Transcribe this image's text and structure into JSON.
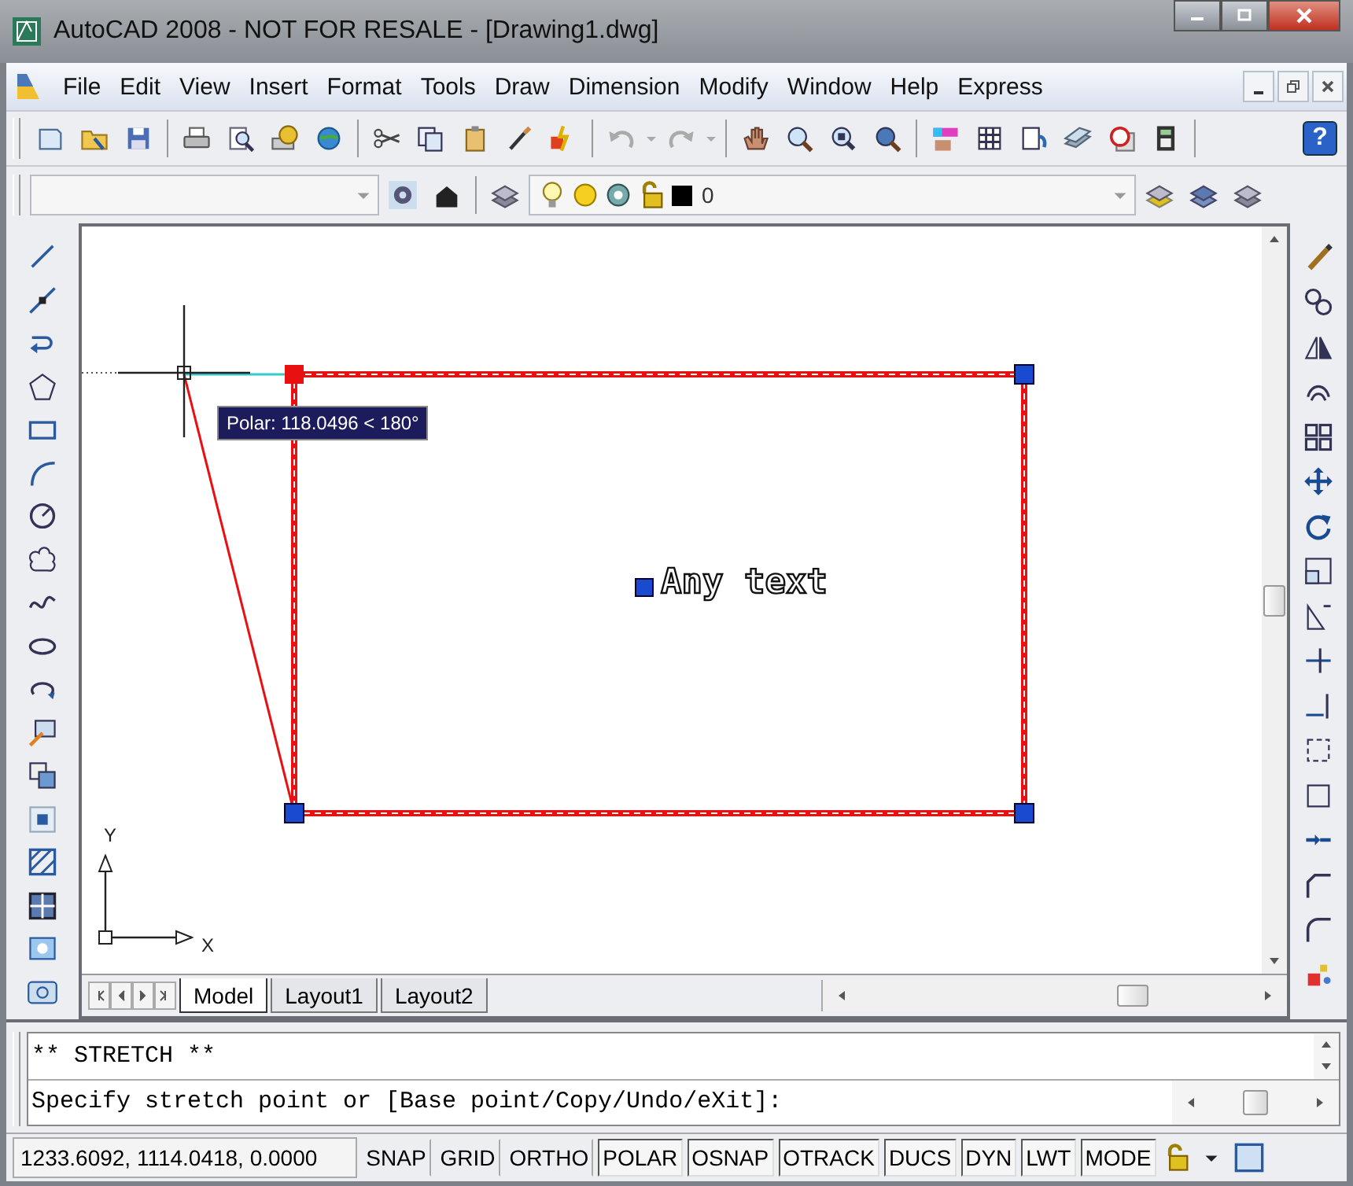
{
  "window": {
    "title": "AutoCAD 2008 - NOT FOR RESALE - [Drawing1.dwg]"
  },
  "menu": {
    "items": [
      "File",
      "Edit",
      "View",
      "Insert",
      "Format",
      "Tools",
      "Draw",
      "Dimension",
      "Modify",
      "Window",
      "Help",
      "Express"
    ]
  },
  "standard_toolbar": {
    "help_button": "?"
  },
  "layers_toolbar": {
    "current_layer": "0"
  },
  "canvas": {
    "tooltip": "Polar: 118.0496 < 180°",
    "text_object": "Any text",
    "ucs": {
      "y_label": "Y",
      "x_label": "X"
    }
  },
  "layout_tabs": [
    {
      "label": "Model",
      "selected": true
    },
    {
      "label": "Layout1",
      "selected": false
    },
    {
      "label": "Layout2",
      "selected": false
    }
  ],
  "command_line": {
    "lines": [
      "** STRETCH **",
      "Specify stretch point or [Base point/Copy/Undo/eXit]:"
    ]
  },
  "status_bar": {
    "coordinates": "1233.6092, 1114.0418, 0.0000",
    "toggles": [
      {
        "label": "SNAP",
        "on": false
      },
      {
        "label": "GRID",
        "on": false
      },
      {
        "label": "ORTHO",
        "on": false
      },
      {
        "label": "POLAR",
        "on": true
      },
      {
        "label": "OSNAP",
        "on": true
      },
      {
        "label": "OTRACK",
        "on": true
      },
      {
        "label": "DUCS",
        "on": true
      },
      {
        "label": "DYN",
        "on": true
      },
      {
        "label": "LWT",
        "on": true
      },
      {
        "label": "MODE",
        "on": true
      }
    ]
  }
}
